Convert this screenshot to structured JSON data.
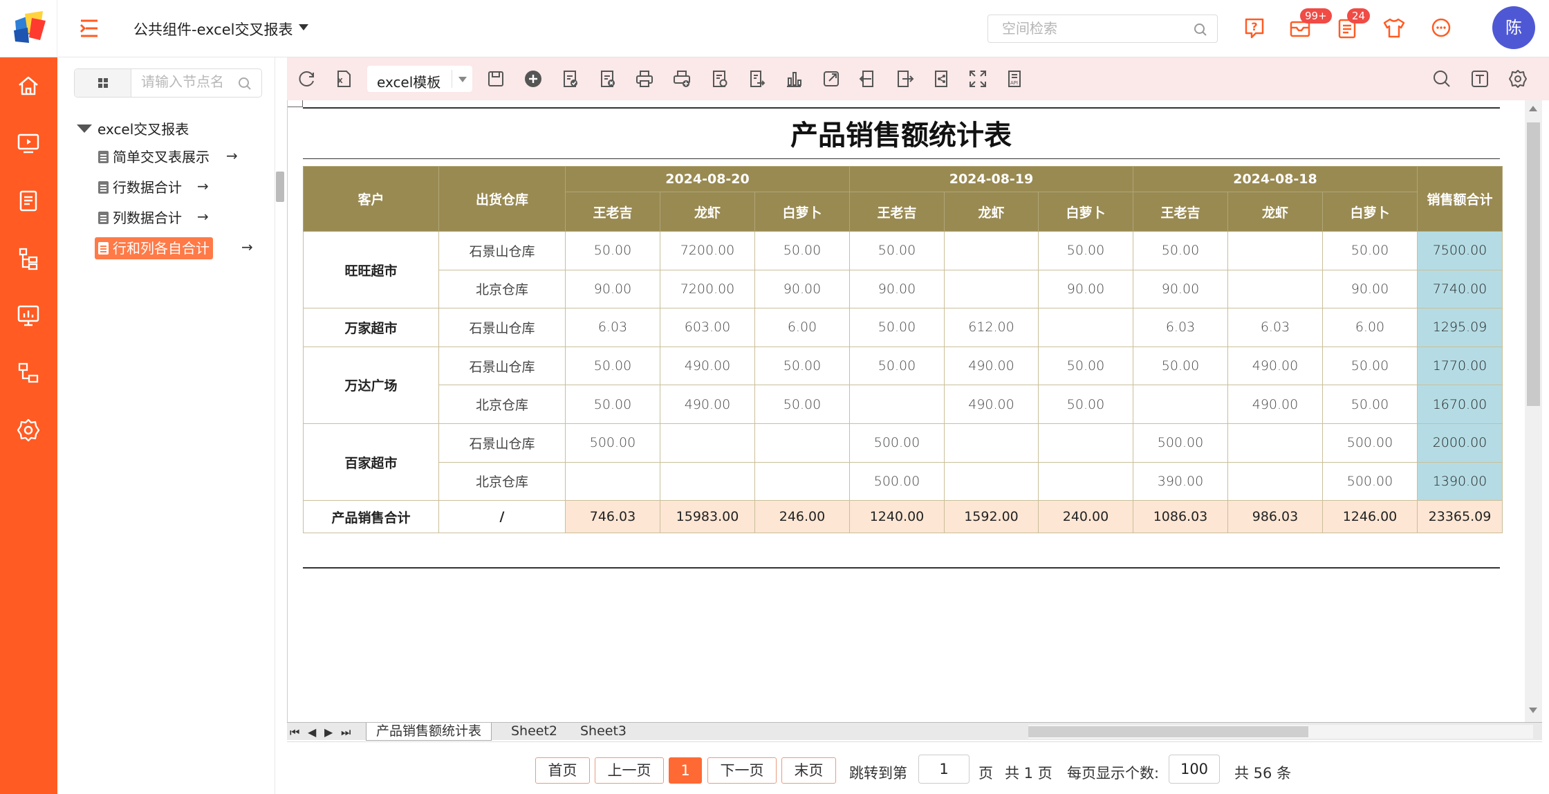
{
  "header": {
    "title": "公共组件-excel交叉报表",
    "search_placeholder": "空间检索",
    "mail_badge": "99+",
    "task_badge": "24",
    "avatar_text": "陈"
  },
  "sidebar": {
    "search_placeholder": "请输入节点名",
    "root": "excel交叉报表",
    "items": [
      {
        "label": "简单交叉表展示"
      },
      {
        "label": "行数据合计"
      },
      {
        "label": "列数据合计"
      },
      {
        "label": "行和列各自合计"
      }
    ]
  },
  "toolbar": {
    "template_label": "excel模板"
  },
  "report": {
    "title": "产品销售额统计表",
    "headers": {
      "customer": "客户",
      "warehouse": "出货仓库",
      "dates": [
        "2024-08-20",
        "2024-08-19",
        "2024-08-18"
      ],
      "products": [
        "王老吉",
        "龙虾",
        "白萝卜"
      ],
      "total": "销售额合计"
    },
    "groups": [
      {
        "customer": "旺旺超市",
        "rows": [
          {
            "warehouse": "石景山仓库",
            "values": [
              "50.00",
              "7200.00",
              "50.00",
              "50.00",
              "",
              "50.00",
              "50.00",
              "",
              "50.00"
            ],
            "total": "7500.00"
          },
          {
            "warehouse": "北京仓库",
            "values": [
              "90.00",
              "7200.00",
              "90.00",
              "90.00",
              "",
              "90.00",
              "90.00",
              "",
              "90.00"
            ],
            "total": "7740.00"
          }
        ]
      },
      {
        "customer": "万家超市",
        "rows": [
          {
            "warehouse": "石景山仓库",
            "values": [
              "6.03",
              "603.00",
              "6.00",
              "50.00",
              "612.00",
              "",
              "6.03",
              "6.03",
              "6.00"
            ],
            "total": "1295.09"
          }
        ]
      },
      {
        "customer": "万达广场",
        "rows": [
          {
            "warehouse": "石景山仓库",
            "values": [
              "50.00",
              "490.00",
              "50.00",
              "50.00",
              "490.00",
              "50.00",
              "50.00",
              "490.00",
              "50.00"
            ],
            "total": "1770.00"
          },
          {
            "warehouse": "北京仓库",
            "values": [
              "50.00",
              "490.00",
              "50.00",
              "",
              "490.00",
              "50.00",
              "",
              "490.00",
              "50.00"
            ],
            "total": "1670.00"
          }
        ]
      },
      {
        "customer": "百家超市",
        "rows": [
          {
            "warehouse": "石景山仓库",
            "values": [
              "500.00",
              "",
              "",
              "500.00",
              "",
              "",
              "500.00",
              "",
              "500.00"
            ],
            "total": "2000.00"
          },
          {
            "warehouse": "北京仓库",
            "values": [
              "",
              "",
              "",
              "500.00",
              "",
              "",
              "390.00",
              "",
              "500.00"
            ],
            "total": "1390.00"
          }
        ]
      }
    ],
    "summary": {
      "label": "产品销售合计",
      "warehouse": "/",
      "values": [
        "746.03",
        "15983.00",
        "246.00",
        "1240.00",
        "1592.00",
        "240.00",
        "1086.03",
        "986.03",
        "1246.00"
      ],
      "total": "23365.09"
    }
  },
  "sheets": [
    "产品销售额统计表",
    "Sheet2",
    "Sheet3"
  ],
  "pager": {
    "first": "首页",
    "prev": "上一页",
    "current": "1",
    "next": "下一页",
    "last": "末页",
    "jump_label": "跳转到第",
    "jump_value": "1",
    "page_unit": "页",
    "total_pages": "共 1 页",
    "per_page_label": "每页显示个数:",
    "per_page_value": "100",
    "total_items": "共 56 条"
  },
  "colors": {
    "brand": "#ff5b23",
    "header_fill": "#998a52",
    "total_fill": "#b5dce4",
    "summary_fill": "#fde6d4"
  }
}
